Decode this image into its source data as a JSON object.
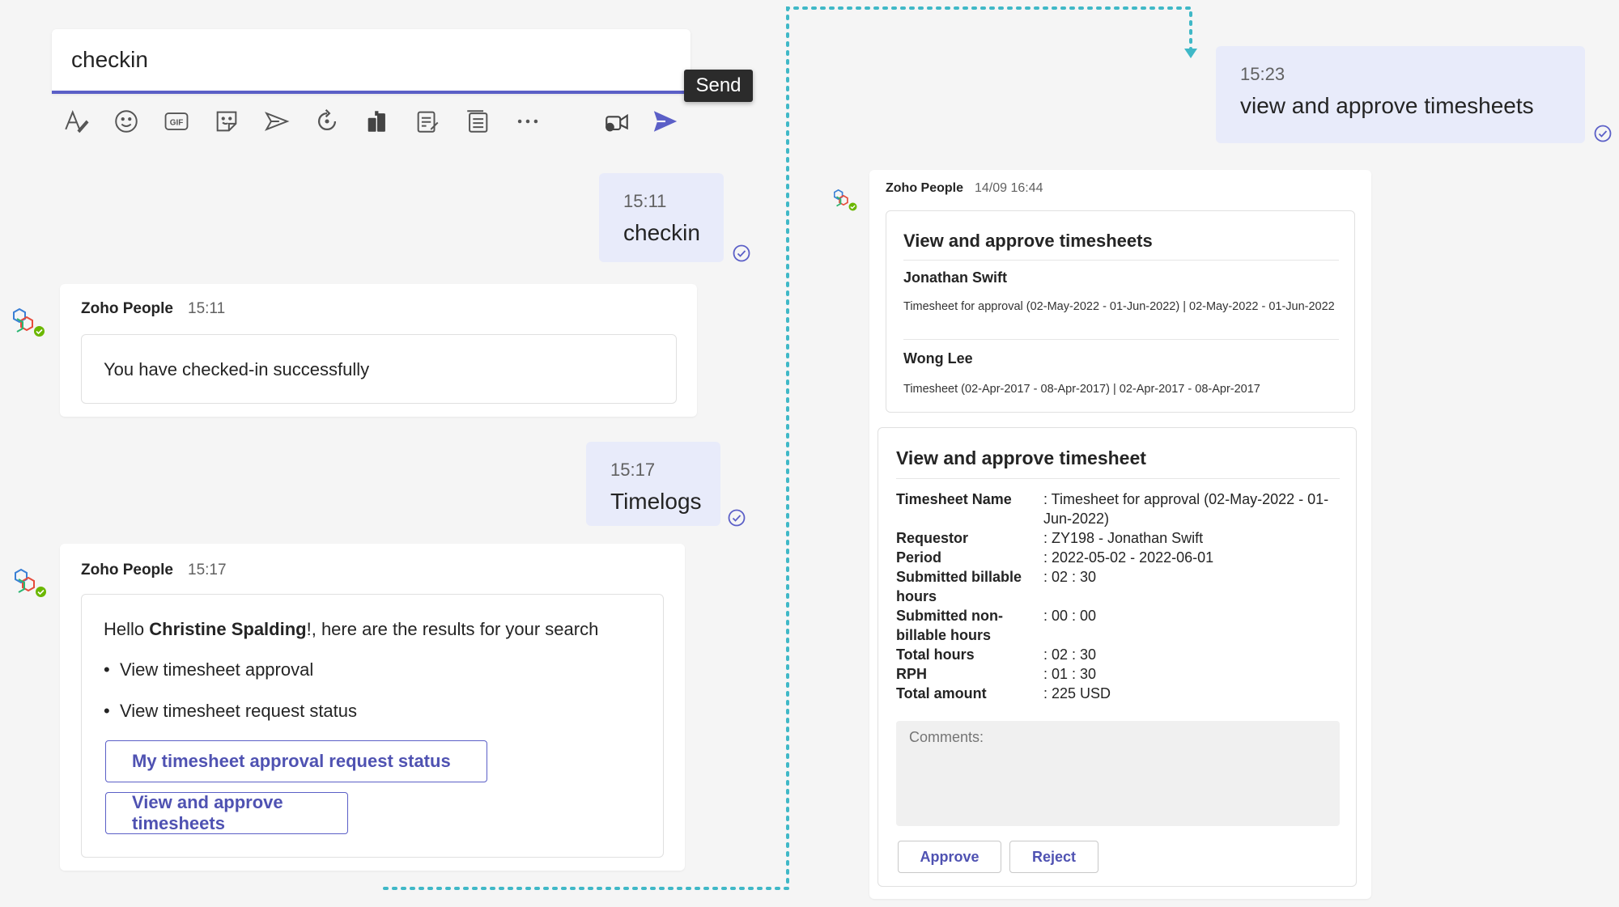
{
  "compose": {
    "text": "checkin",
    "send_tooltip": "Send"
  },
  "toolbar": {
    "icons": [
      "format-icon",
      "emoji-icon",
      "gif-icon",
      "sticker-icon",
      "loop-icon",
      "refresh-icon",
      "praise-icon",
      "notes-icon",
      "tasks-icon",
      "more-icon",
      "meet-now-icon",
      "send-icon"
    ]
  },
  "messages": {
    "m1": {
      "time": "15:11",
      "text": "checkin"
    },
    "m2": {
      "time": "15:17",
      "text": "Timelogs"
    },
    "m3": {
      "time": "15:23",
      "text": "view and approve timesheets"
    }
  },
  "bot1": {
    "sender": "Zoho People",
    "time": "15:11",
    "text": "You have checked-in successfully"
  },
  "bot2": {
    "sender": "Zoho People",
    "time": "15:17",
    "hello": "Hello ",
    "user": "Christine Spalding",
    "rest": "!, here are the results for your search",
    "bullets": [
      "View timesheet approval",
      "View timesheet request status"
    ],
    "buttons": [
      "My timesheet approval request status",
      "View and approve timesheets"
    ]
  },
  "bot3": {
    "sender": "Zoho People",
    "time": "14/09 16:44",
    "list_title": "View and approve timesheets",
    "items": [
      {
        "name": "Jonathan Swift",
        "detail": "Timesheet for approval (02-May-2022 - 01-Jun-2022) | 02-May-2022 - 01-Jun-2022"
      },
      {
        "name": "Wong Lee",
        "detail": "Timesheet (02-Apr-2017 - 08-Apr-2017) | 02-Apr-2017 - 08-Apr-2017"
      }
    ],
    "detail_title": "View and approve timesheet",
    "fields": [
      {
        "k": "Timesheet Name",
        "v": ": Timesheet for approval (02-May-2022 - 01-Jun-2022)"
      },
      {
        "k": "Requestor",
        "v": ": ZY198 - Jonathan Swift"
      },
      {
        "k": "Period",
        "v": ": 2022-05-02 - 2022-06-01"
      },
      {
        "k": "Submitted billable hours",
        "v": ": 02 : 30"
      },
      {
        "k": "Submitted non-billable hours",
        "v": ": 00 : 00"
      },
      {
        "k": "Total hours",
        "v": ": 02 : 30"
      },
      {
        "k": "RPH",
        "v": ": 01 : 30"
      },
      {
        "k": "Total amount",
        "v": ": 225 USD"
      }
    ],
    "comments_placeholder": "Comments:",
    "approve": "Approve",
    "reject": "Reject"
  },
  "colors": {
    "accent": "#5b5fc7",
    "bubble": "#e8ebfa",
    "connector": "#3fb8c7"
  }
}
